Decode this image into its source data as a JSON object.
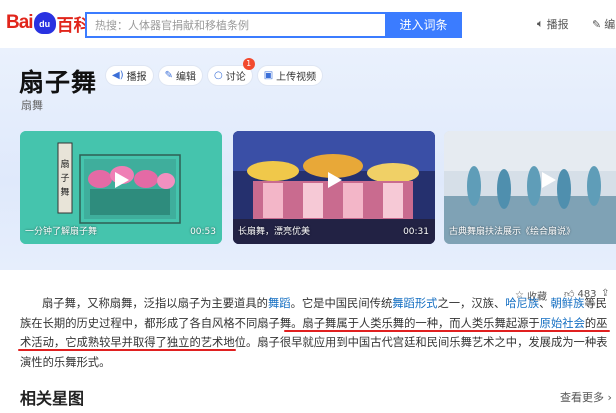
{
  "header": {
    "logo_bai": "Bai",
    "logo_du": "du",
    "logo_baike": "百科",
    "search_placeholder": "热搜：人体器官捐献和移植条例",
    "search_button": "进入词条",
    "broadcast": "播报",
    "edit": "编"
  },
  "entry": {
    "title": "扇子舞",
    "subtitle": "扇舞",
    "actions": [
      {
        "icon": "speaker-icon",
        "label": "播报"
      },
      {
        "icon": "pencil-icon",
        "label": "编辑"
      },
      {
        "icon": "chat-bubble-icon",
        "label": "讨论",
        "badge": "1"
      },
      {
        "icon": "video-upload-icon",
        "label": "上传视频"
      }
    ]
  },
  "videos": [
    {
      "caption": "一分钟了解扇子舞",
      "duration": "00:53"
    },
    {
      "caption": "长扇舞，漂亮优美",
      "duration": "00:31"
    },
    {
      "caption": "古典舞扇扶法展示《绘合扇说》",
      "duration": ""
    }
  ],
  "meta": {
    "collect": "收藏",
    "likes": "483"
  },
  "paragraph": {
    "s1": "扇子舞，又称扇舞，泛指以扇子为主要道具的",
    "l1": "舞蹈",
    "s2": "。它是中国民间传统",
    "l2": "舞蹈形式",
    "s3": "之一，汉族、",
    "l3": "哈尼族",
    "s4": "、",
    "l4": "朝鲜族",
    "s5": "等民族在长期的历史过程中，都形成了各自风格不同扇子舞。扇子舞属于人类乐舞的一种，而人类乐舞起源于",
    "l5": "原始社会",
    "s6": "的巫术活动，它成熟较早并取得了独立的艺术地位。扇子很早就应用到中国古代宫廷和民间乐舞艺术之中，发展成为一种表演性的乐舞形式。"
  },
  "related": {
    "title": "相关星图",
    "more": "查看更多"
  },
  "colors": {
    "brand_blue": "#3b7cff",
    "baidu_red": "#e1251b",
    "link": "#136ec2",
    "underline": "#e02020"
  }
}
